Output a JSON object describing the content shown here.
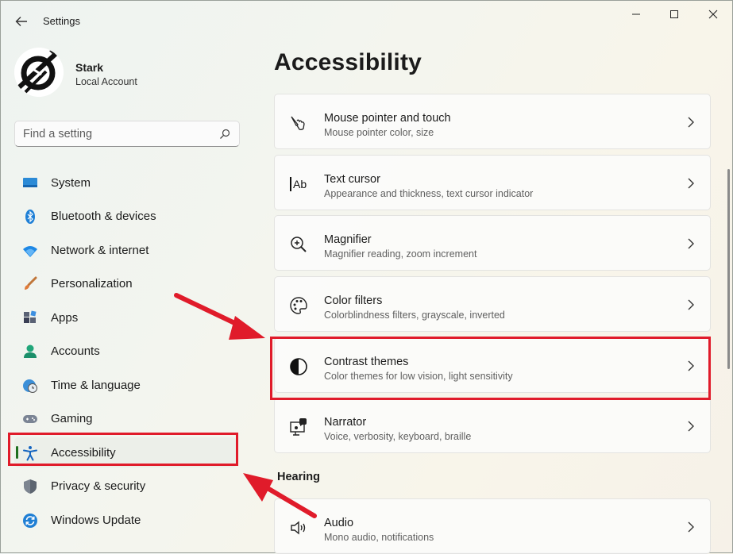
{
  "window": {
    "title": "Settings"
  },
  "profile": {
    "name": "Stark",
    "account_type": "Local Account"
  },
  "search": {
    "placeholder": "Find a setting"
  },
  "sidebar": {
    "items": [
      {
        "label": "System",
        "icon": "monitor-icon"
      },
      {
        "label": "Bluetooth & devices",
        "icon": "bluetooth-icon"
      },
      {
        "label": "Network & internet",
        "icon": "wifi-icon"
      },
      {
        "label": "Personalization",
        "icon": "brush-icon"
      },
      {
        "label": "Apps",
        "icon": "apps-icon"
      },
      {
        "label": "Accounts",
        "icon": "person-icon"
      },
      {
        "label": "Time & language",
        "icon": "clock-globe-icon"
      },
      {
        "label": "Gaming",
        "icon": "gamepad-icon"
      },
      {
        "label": "Accessibility",
        "icon": "accessibility-icon",
        "selected": true
      },
      {
        "label": "Privacy & security",
        "icon": "shield-icon"
      },
      {
        "label": "Windows Update",
        "icon": "update-icon"
      }
    ]
  },
  "main": {
    "title": "Accessibility",
    "cards": [
      {
        "title": "Mouse pointer and touch",
        "subtitle": "Mouse pointer color, size",
        "icon": "mouse-pointer-icon"
      },
      {
        "title": "Text cursor",
        "subtitle": "Appearance and thickness, text cursor indicator",
        "icon": "text-cursor-icon"
      },
      {
        "title": "Magnifier",
        "subtitle": "Magnifier reading, zoom increment",
        "icon": "magnifier-icon"
      },
      {
        "title": "Color filters",
        "subtitle": "Colorblindness filters, grayscale, inverted",
        "icon": "palette-icon"
      },
      {
        "title": "Contrast themes",
        "subtitle": "Color themes for low vision, light sensitivity",
        "icon": "contrast-icon"
      },
      {
        "title": "Narrator",
        "subtitle": "Voice, verbosity, keyboard, braille",
        "icon": "narrator-icon"
      }
    ],
    "hearing_section": "Hearing",
    "hearing_cards": [
      {
        "title": "Audio",
        "subtitle": "Mono audio, notifications",
        "icon": "speaker-icon"
      }
    ]
  },
  "colors": {
    "highlight": "#e01b2a",
    "accent": "#0067c0",
    "active_indicator": "#1e6f1e"
  }
}
